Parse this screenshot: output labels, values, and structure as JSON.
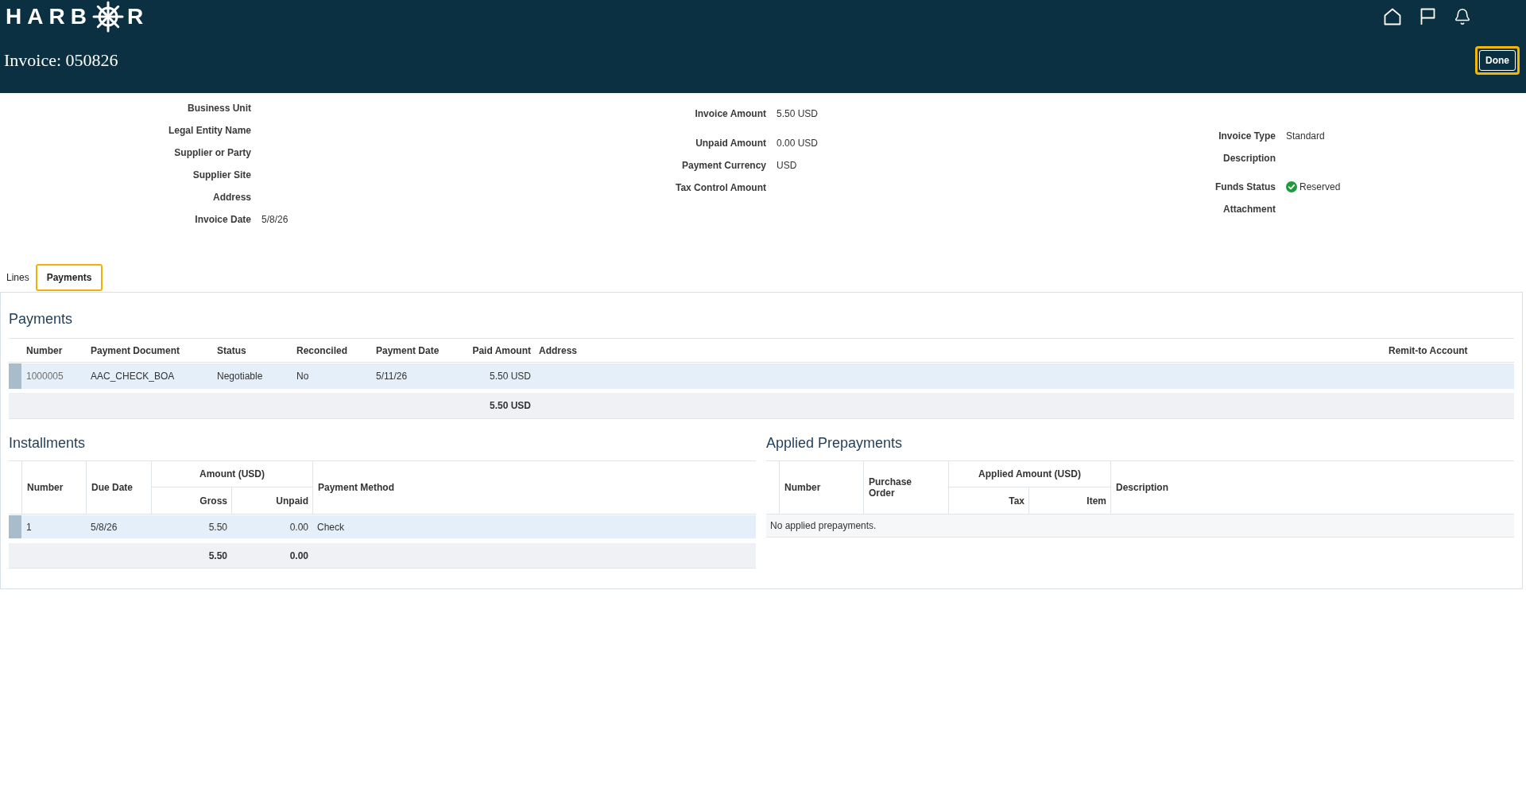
{
  "header": {
    "logo": {
      "lead": "HARB",
      "tail": "R"
    },
    "title": "Invoice: 050826",
    "done_button": {
      "label": "Done",
      "focused": true
    }
  },
  "summary": {
    "columns": [
      {
        "fields": [
          {
            "kind": "text",
            "label": "Business Unit"
          },
          {
            "kind": "text",
            "label": "Legal Entity Name"
          },
          {
            "kind": "text",
            "label": "Supplier or Party"
          },
          {
            "kind": "text",
            "label": "Supplier Site"
          },
          {
            "kind": "text",
            "label": "Address"
          },
          {
            "kind": "text",
            "label": "Invoice Date",
            "value": "5/8/26"
          }
        ]
      },
      {
        "fields": [
          {
            "kind": "text",
            "label": "Invoice Amount",
            "value": "5.50 USD"
          },
          {
            "kind": "text",
            "label": "Unpaid Amount",
            "value": "0.00 USD"
          },
          {
            "kind": "text",
            "label": "Payment Currency",
            "value": "USD"
          },
          {
            "kind": "text",
            "label": "Tax Control Amount"
          }
        ]
      },
      {
        "fields": [
          {
            "kind": "text",
            "label": "Invoice Type",
            "value": "Standard"
          },
          {
            "kind": "text",
            "label": "Description"
          },
          {
            "kind": "status",
            "label": "Funds Status",
            "value": "Reserved"
          },
          {
            "kind": "text",
            "label": "Attachment"
          }
        ]
      }
    ]
  },
  "tabs": [
    {
      "label": "Lines",
      "selected": false
    },
    {
      "label": "Payments",
      "selected": true
    }
  ],
  "payments": {
    "title": "Payments",
    "columns": [
      {
        "label": "Number"
      },
      {
        "label": "Payment Document"
      },
      {
        "label": "Status"
      },
      {
        "label": "Reconciled"
      },
      {
        "label": "Payment Date"
      },
      {
        "label": "Paid Amount"
      },
      {
        "label": "Address"
      },
      {
        "label": "Remit-to Account"
      }
    ],
    "rows": [
      {
        "selected": true,
        "number": "1000005",
        "payment_document": "AAC_CHECK_BOA",
        "status": "Negotiable",
        "reconciled": "No",
        "payment_date": "5/11/26",
        "paid_amount": "5.50 USD"
      }
    ],
    "total": "5.50 USD"
  },
  "installments": {
    "title": "Installments",
    "columns": [
      {
        "label": "Number"
      },
      {
        "label": "Due Date"
      },
      {
        "label": "Amount (USD)",
        "children": [
          {
            "label": "Gross"
          },
          {
            "label": "Unpaid"
          }
        ]
      },
      {
        "label": "Payment Method"
      }
    ],
    "rows": [
      {
        "selected": true,
        "number": "1",
        "due_date": "5/8/26",
        "gross": "5.50",
        "unpaid": "0.00",
        "payment_method": "Check"
      }
    ],
    "totals": {
      "gross": "5.50",
      "unpaid": "0.00"
    }
  },
  "applied_prepayments": {
    "title": "Applied Prepayments",
    "columns": [
      {
        "label": "Number"
      },
      {
        "label": "Purchase Order"
      },
      {
        "label": "Applied Amount (USD)",
        "children": [
          {
            "label": "Tax"
          },
          {
            "label": "Item"
          }
        ]
      },
      {
        "label": "Description"
      }
    ],
    "empty_message": "No applied prepayments."
  }
}
